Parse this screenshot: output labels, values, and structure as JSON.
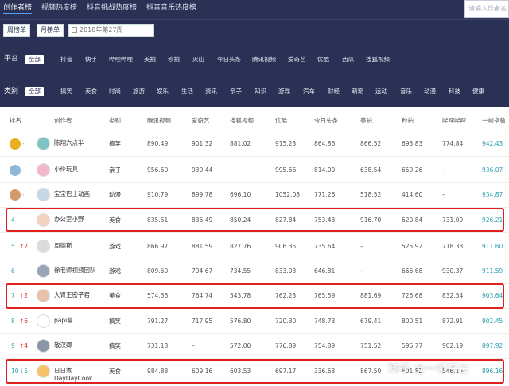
{
  "tabs": [
    "创作者榜",
    "视频热度榜",
    "抖音挑战热度榜",
    "抖音音乐热度榜"
  ],
  "search_placeholder": "请输入作者名",
  "period": {
    "weekly": "周榜单",
    "monthly": "月榜单",
    "date": "2018年第27周"
  },
  "platform": {
    "label": "平台",
    "options": [
      "全部",
      "抖音",
      "快手",
      "哔哩哔哩",
      "美拍",
      "秒拍",
      "火山",
      "今日头条",
      "腾讯视频",
      "爱奇艺",
      "优酷",
      "西瓜",
      "搜狐视频"
    ]
  },
  "category": {
    "label": "类别",
    "options": [
      "全部",
      "搞笑",
      "美食",
      "时尚",
      "旅游",
      "娱乐",
      "生活",
      "资讯",
      "亲子",
      "知识",
      "游戏",
      "汽车",
      "财经",
      "萌宠",
      "运动",
      "音乐",
      "动漫",
      "科技",
      "健康"
    ]
  },
  "columns": [
    "排名",
    "创作者",
    "类别",
    "腾讯视频",
    "爱奇艺",
    "搜狐视频",
    "优酷",
    "今日头条",
    "美拍",
    "秒拍",
    "哔哩哔哩",
    "一帧指数"
  ],
  "rows": [
    {
      "rank": "",
      "change": "-",
      "name": "陈翔六点半",
      "cat": "搞笑",
      "v": [
        "890.49",
        "901.32",
        "881.02",
        "915.23",
        "864.86",
        "866.52",
        "693.83",
        "774.84"
      ],
      "index": "942.43"
    },
    {
      "rank": "",
      "change": "-",
      "name": "小伶玩具",
      "cat": "亲子",
      "v": [
        "956.60",
        "930.44",
        "–",
        "995.66",
        "814.00",
        "638.54",
        "659.26",
        "–"
      ],
      "index": "936.07"
    },
    {
      "rank": "",
      "change": "-",
      "name": "宝宝巴士动画",
      "cat": "动漫",
      "v": [
        "910.79",
        "899.78",
        "696.10",
        "1052.08",
        "771.26",
        "518.52",
        "414.60",
        "–"
      ],
      "index": "934.87"
    },
    {
      "rank": "4",
      "change": "-",
      "name": "办公室小野",
      "cat": "美食",
      "v": [
        "835.51",
        "836.49",
        "850.24",
        "827.84",
        "753.43",
        "916.70",
        "620.84",
        "731.09"
      ],
      "index": "926.21"
    },
    {
      "rank": "5",
      "change": "↑2",
      "name": "周德斯",
      "cat": "游戏",
      "v": [
        "866.97",
        "881.59",
        "827.76",
        "906.35",
        "735.64",
        "–",
        "525.92",
        "718.33"
      ],
      "index": "911.60"
    },
    {
      "rank": "6",
      "change": "-",
      "name": "徐老师视频团队",
      "cat": "游戏",
      "v": [
        "809.60",
        "794.67",
        "734.55",
        "833.03",
        "646.81",
        "–",
        "666.68",
        "930.37"
      ],
      "index": "911.59"
    },
    {
      "rank": "7",
      "change": "↑2",
      "name": "大胃王密子君",
      "cat": "美食",
      "v": [
        "574.36",
        "764.74",
        "543.78",
        "762.23",
        "765.59",
        "881.69",
        "726.68",
        "832.54"
      ],
      "index": "903.64"
    },
    {
      "rank": "8",
      "change": "↑6",
      "name": "papi酱",
      "cat": "搞笑",
      "v": [
        "791.27",
        "717.95",
        "576.80",
        "720.30",
        "748.73",
        "679.41",
        "800.51",
        "872.91"
      ],
      "index": "902.45"
    },
    {
      "rank": "9",
      "change": "↑4",
      "name": "敬汉卿",
      "cat": "搞笑",
      "v": [
        "731.18",
        "–",
        "572.00",
        "776.89",
        "754.89",
        "751.52",
        "596.77",
        "902.19"
      ],
      "index": "897.92"
    },
    {
      "rank": "10",
      "change": "↓5",
      "name": "日日煮DayDayCook",
      "cat": "美食",
      "v": [
        "984.88",
        "609.16",
        "603.53",
        "697.17",
        "336.63",
        "867.50",
        "801.82",
        "546.15"
      ],
      "index": "896.16"
    }
  ],
  "watermark": "知乎 @一帧平台",
  "colors": {
    "header_bg": "#2b3154",
    "index_text": "#2aa0b0",
    "highlight": "#e0201a",
    "rise": "#e0201a",
    "fall": "#2aa0b0"
  }
}
